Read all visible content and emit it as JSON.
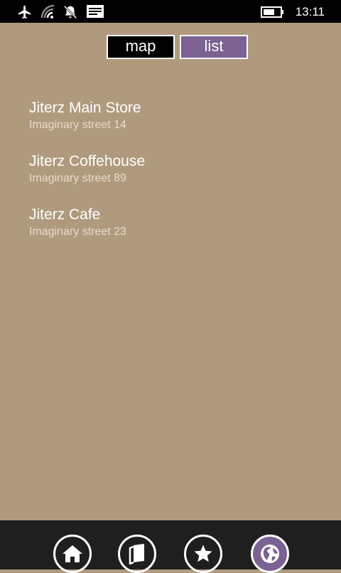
{
  "status_bar": {
    "time": "13:11",
    "icons": [
      "airplane-icon",
      "wifi-icon",
      "alarm-off-icon",
      "message-icon",
      "battery-icon"
    ]
  },
  "view_toggle": {
    "map_label": "map",
    "list_label": "list",
    "selected": "list"
  },
  "locations": [
    {
      "name": "Jiterz Main Store",
      "address": "Imaginary street 14"
    },
    {
      "name": "Jiterz Coffehouse",
      "address": "Imaginary street 89"
    },
    {
      "name": "Jiterz Cafe",
      "address": "Imaginary street 23"
    }
  ],
  "app_bar": {
    "buttons": [
      "home-icon",
      "menu-icon",
      "favorites-icon",
      "locations-icon"
    ],
    "active": "locations-icon"
  },
  "colors": {
    "background": "#b09a7e",
    "accent": "#7b6292",
    "app_bar": "#1f1f1f"
  }
}
